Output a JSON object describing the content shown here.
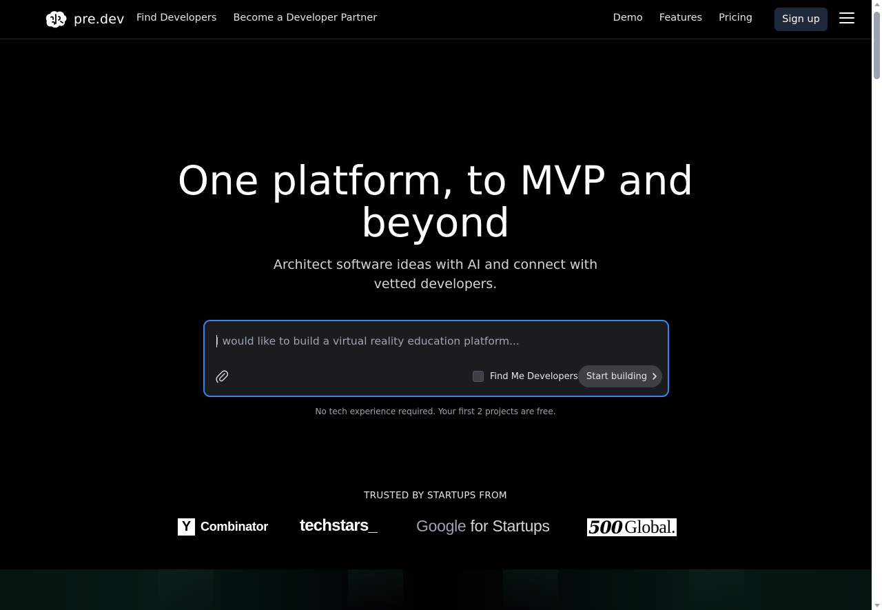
{
  "header": {
    "brand": "pre.dev",
    "nav_left": [
      "Find Developers",
      "Become a Developer Partner"
    ],
    "nav_right": [
      "Demo",
      "Features",
      "Pricing"
    ],
    "signup_label": "Sign up"
  },
  "hero": {
    "title": "One platform, to MVP and beyond",
    "subtitle": "Architect software ideas with AI and connect with vetted developers."
  },
  "prompt": {
    "placeholder": "I would like to build a virtual reality education platform...",
    "find_devs_label": "Find Me Developers",
    "find_devs_checked": false,
    "start_label": "Start building",
    "accent_color": "#3b82f6"
  },
  "note": "No tech experience required. Your first 2 projects are free.",
  "trusted": {
    "heading": "TRUSTED BY STARTUPS FROM",
    "yc_mark": "Y",
    "yc_text": "Combinator",
    "techstars": "techstars_",
    "google_word": "Google",
    "google_suffix": " for Startups",
    "g500_num": "500",
    "g500_word": "Global."
  },
  "icons": [
    "brain-logo-icon",
    "menu-icon",
    "paperclip-icon",
    "chevron-right-icon"
  ]
}
